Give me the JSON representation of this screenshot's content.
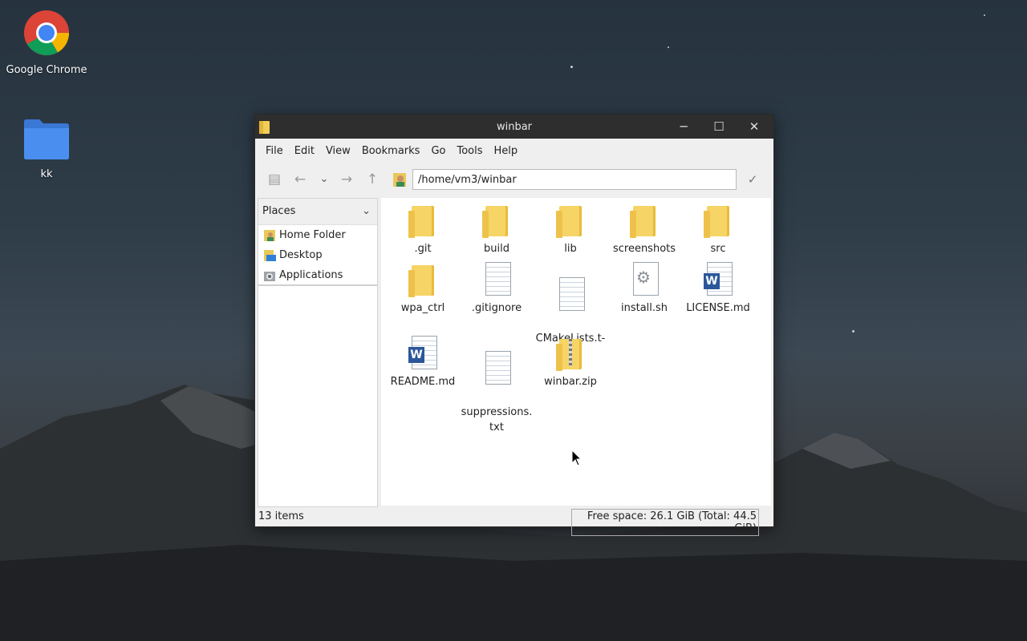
{
  "desktop": {
    "icons": [
      {
        "label": "Google Chrome"
      },
      {
        "label": "kk"
      }
    ]
  },
  "window": {
    "title": "winbar",
    "controls": {
      "minimize": "─",
      "maximize": "☐",
      "close": "✕"
    },
    "menu": [
      "File",
      "Edit",
      "View",
      "Bookmarks",
      "Go",
      "Tools",
      "Help"
    ],
    "toolbar": {
      "path": "/home/vm3/winbar",
      "icons": [
        "view-icon",
        "back-arrow-icon",
        "history-dropdown-icon",
        "forward-arrow-icon",
        "up-arrow-icon",
        "home-icon",
        "clear-icon"
      ]
    },
    "sidebar": {
      "header": "Places",
      "items": [
        {
          "label": "Home Folder",
          "icon": "home-folder-icon"
        },
        {
          "label": "Desktop",
          "icon": "desktop-icon"
        },
        {
          "label": "Applications",
          "icon": "applications-icon"
        }
      ]
    },
    "files": [
      {
        "name": ".git",
        "type": "folder"
      },
      {
        "name": "build",
        "type": "folder"
      },
      {
        "name": "lib",
        "type": "folder"
      },
      {
        "name": "screenshots",
        "type": "folder"
      },
      {
        "name": "src",
        "type": "folder"
      },
      {
        "name": "wpa_ctrl",
        "type": "folder"
      },
      {
        "name": ".gitignore",
        "type": "text"
      },
      {
        "name": "CMakeLists.t-\nxt",
        "type": "text"
      },
      {
        "name": "install.sh",
        "type": "script"
      },
      {
        "name": "LICENSE.md",
        "type": "word"
      },
      {
        "name": "README.md",
        "type": "word"
      },
      {
        "name": "suppressions.\ntxt",
        "type": "text"
      },
      {
        "name": "winbar.zip",
        "type": "zip"
      }
    ],
    "status": {
      "items": "13 items",
      "free_space": "Free space: 26.1 GiB (Total: 44.5 GiB)"
    }
  },
  "colors": {
    "titlebar": "#2e2e2e",
    "folder": "#f6d465",
    "word": "#2b579a"
  }
}
